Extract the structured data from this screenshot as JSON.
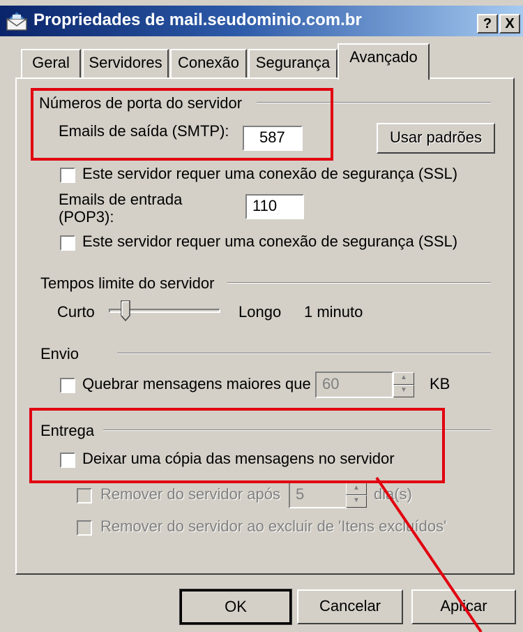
{
  "window": {
    "title": "Propriedades de mail.seudominio.com.br",
    "help_button": "?",
    "close_button": "X"
  },
  "tabs": [
    {
      "label": "Geral",
      "active": false
    },
    {
      "label": "Servidores",
      "active": false
    },
    {
      "label": "Conexão",
      "active": false
    },
    {
      "label": "Segurança",
      "active": false
    },
    {
      "label": "Avançado",
      "active": true
    }
  ],
  "port_section": {
    "title": "Números de porta do servidor",
    "smtp_label": "Emails de saída (SMTP):",
    "smtp_value": "587",
    "use_defaults_button": "Usar padrões",
    "ssl_smtp_label": "Este servidor requer uma conexão de segurança (SSL)",
    "pop3_label_line1": "Emails de entrada",
    "pop3_label_line2": "(POP3):",
    "pop3_value": "110",
    "ssl_pop3_label": "Este servidor requer uma conexão de segurança (SSL)"
  },
  "timeout_section": {
    "title": "Tempos limite do servidor",
    "short_label": "Curto",
    "long_label": "Longo",
    "value_text": "1 minuto",
    "slider_level": 0.15
  },
  "send_section": {
    "title": "Envio",
    "split_label": "Quebrar mensagens maiores que",
    "split_value": "60",
    "unit": "KB"
  },
  "delivery_section": {
    "title": "Entrega",
    "leave_copy_label": "Deixar uma cópia das mensagens no servidor",
    "remove_after_label": "Remover do servidor após",
    "remove_after_value": "5",
    "remove_after_unit": "dia(s)",
    "remove_on_delete_label": "Remover do servidor ao excluir de 'Itens excluídos'"
  },
  "buttons": {
    "ok": "OK",
    "cancel": "Cancelar",
    "apply": "Aplicar"
  },
  "colors": {
    "title_gradient_start": "#0a246a",
    "title_gradient_end": "#a6caf0",
    "dialog_face": "#d4d0c8",
    "highlight_annotation": "#e1000f"
  },
  "icons": {
    "title_icon": "envelope-icon",
    "spin_up": "spin-up-icon",
    "spin_down": "spin-down-icon"
  }
}
